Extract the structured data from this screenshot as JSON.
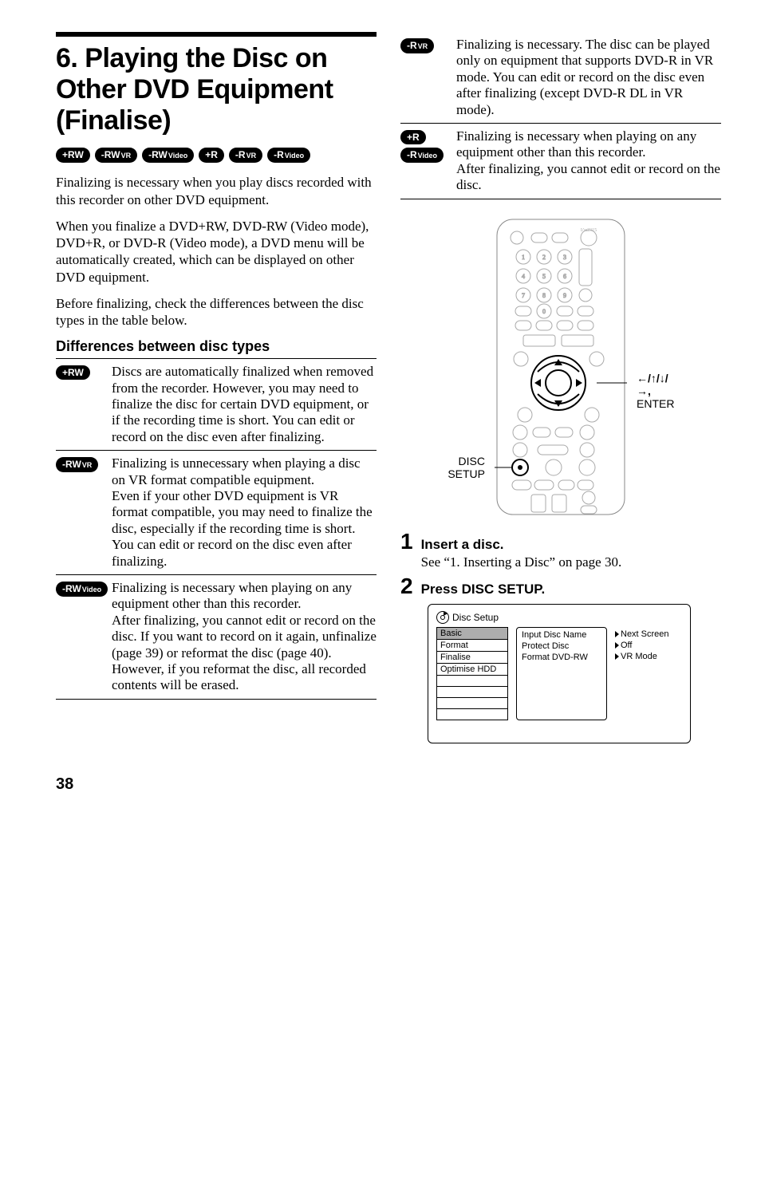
{
  "title": "6. Playing the Disc on Other DVD Equipment (Finalise)",
  "top_badges": [
    "+RW",
    "-RWVR",
    "-RWVideo",
    "+R",
    "-RVR",
    "-RVideo"
  ],
  "intro1": "Finalizing is necessary when you play discs recorded with this recorder on other DVD equipment.",
  "intro2": "When you finalize a DVD+RW, DVD-RW (Video mode), DVD+R, or DVD-R (Video mode), a DVD menu will be automatically created, which can be displayed on other DVD equipment.",
  "intro3": "Before finalizing, check the differences between the disc types in the table below.",
  "diff_heading": "Differences between disc types",
  "diff_rows": [
    {
      "badges": [
        "+RW"
      ],
      "text": "Discs are automatically finalized when removed from the recorder. However, you may need to finalize the disc for certain DVD equipment, or if the recording time is short. You can edit or record on the disc even after finalizing."
    },
    {
      "badges": [
        "-RWVR"
      ],
      "text": "Finalizing is unnecessary when playing a disc on VR format compatible equipment.\nEven if your other DVD equipment is VR format compatible, you may need to finalize the disc, especially if the recording time is short. You can edit or record on the disc even after finalizing."
    },
    {
      "badges": [
        "-RWVideo"
      ],
      "text": "Finalizing is necessary when playing on any equipment other than this recorder.\nAfter finalizing, you cannot edit or record on the disc. If you want to record on it again, unfinalize (page 39) or reformat the disc (page 40). However, if you reformat the disc, all recorded contents will be erased."
    }
  ],
  "right_rows": [
    {
      "badges": [
        "-RVR"
      ],
      "text": "Finalizing is necessary. The disc can be played only on equipment that supports DVD-R in VR mode. You can edit or record on the disc even after finalizing (except DVD-R DL in VR mode)."
    },
    {
      "badges": [
        "+R",
        "-RVideo"
      ],
      "text": "Finalizing is necessary when playing on any equipment other than this recorder.\nAfter finalizing, you cannot edit or record on the disc."
    }
  ],
  "remote_labels": {
    "arrows": "←/↑/↓/→,",
    "enter": "ENTER",
    "disc": "DISC",
    "setup": "SETUP"
  },
  "steps": [
    {
      "num": "1",
      "title": "Insert a disc.",
      "text": "See “1. Inserting a Disc” on page 30."
    },
    {
      "num": "2",
      "title": "Press DISC SETUP.",
      "text": ""
    }
  ],
  "screenshot": {
    "title": "Disc Setup",
    "left": [
      "Basic",
      "Format",
      "Finalise",
      "Optimise HDD"
    ],
    "mid": [
      "Input Disc Name",
      "Protect Disc",
      "Format DVD-RW"
    ],
    "right": [
      "Next Screen",
      "Off",
      "VR Mode"
    ]
  },
  "page_number": "38"
}
